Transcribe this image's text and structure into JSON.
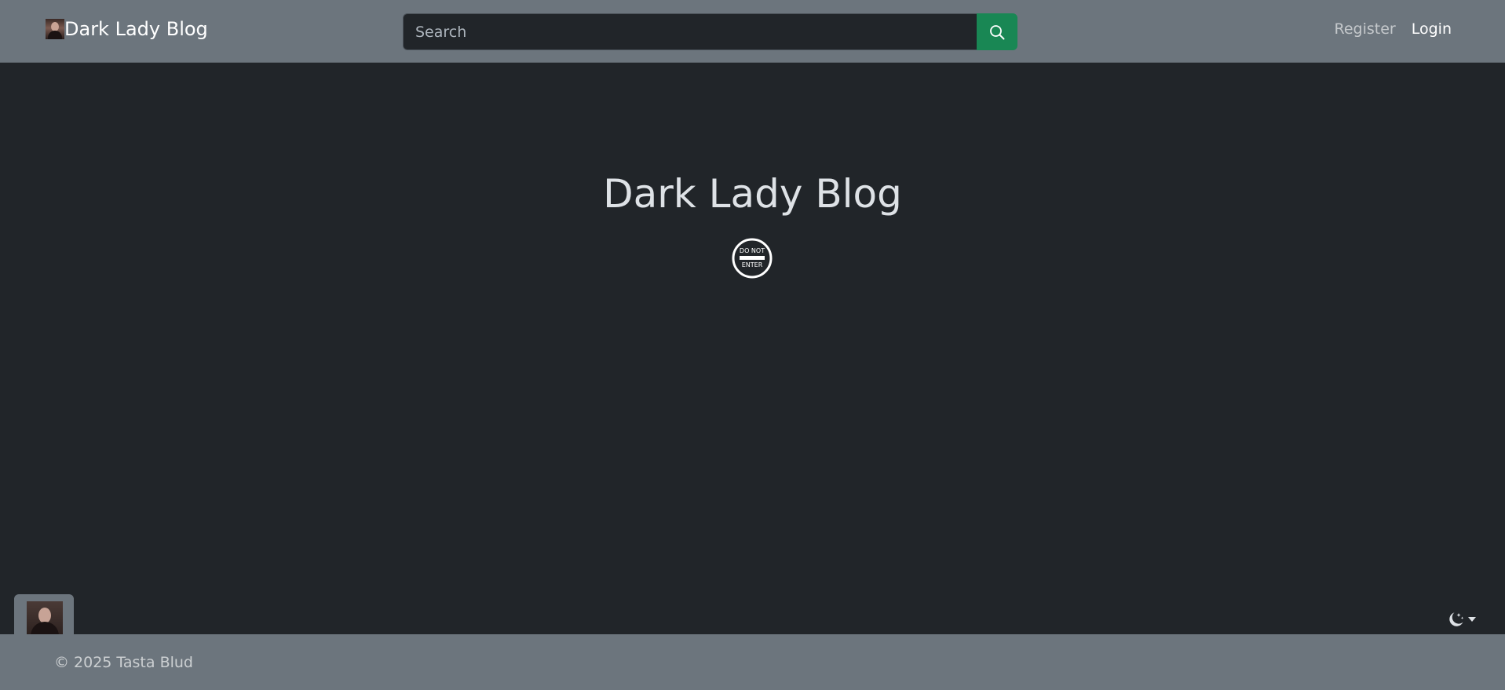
{
  "navbar": {
    "brand": "Dark Lady Blog",
    "brand_icon": "profile-avatar-thumbnail",
    "search": {
      "placeholder": "Search",
      "value": "",
      "button_icon": "search-icon",
      "button_color": "#198754"
    },
    "links": {
      "register": "Register",
      "login": "Login"
    }
  },
  "hero": {
    "title": "Dark Lady Blog",
    "logo_icon": "do-not-enter-sign-icon",
    "logo_text_top": "DO NOT",
    "logo_text_bottom": "ENTER"
  },
  "floating": {
    "avatar_icon": "profile-avatar",
    "theme_toggle_icon": "moon-stars-icon"
  },
  "footer": {
    "copyright": "© 2025 Tasta Blud"
  },
  "colors": {
    "navbar_bg": "#6c757d",
    "body_bg": "#212529",
    "accent_green": "#198754",
    "text_light": "#dee2e6"
  }
}
